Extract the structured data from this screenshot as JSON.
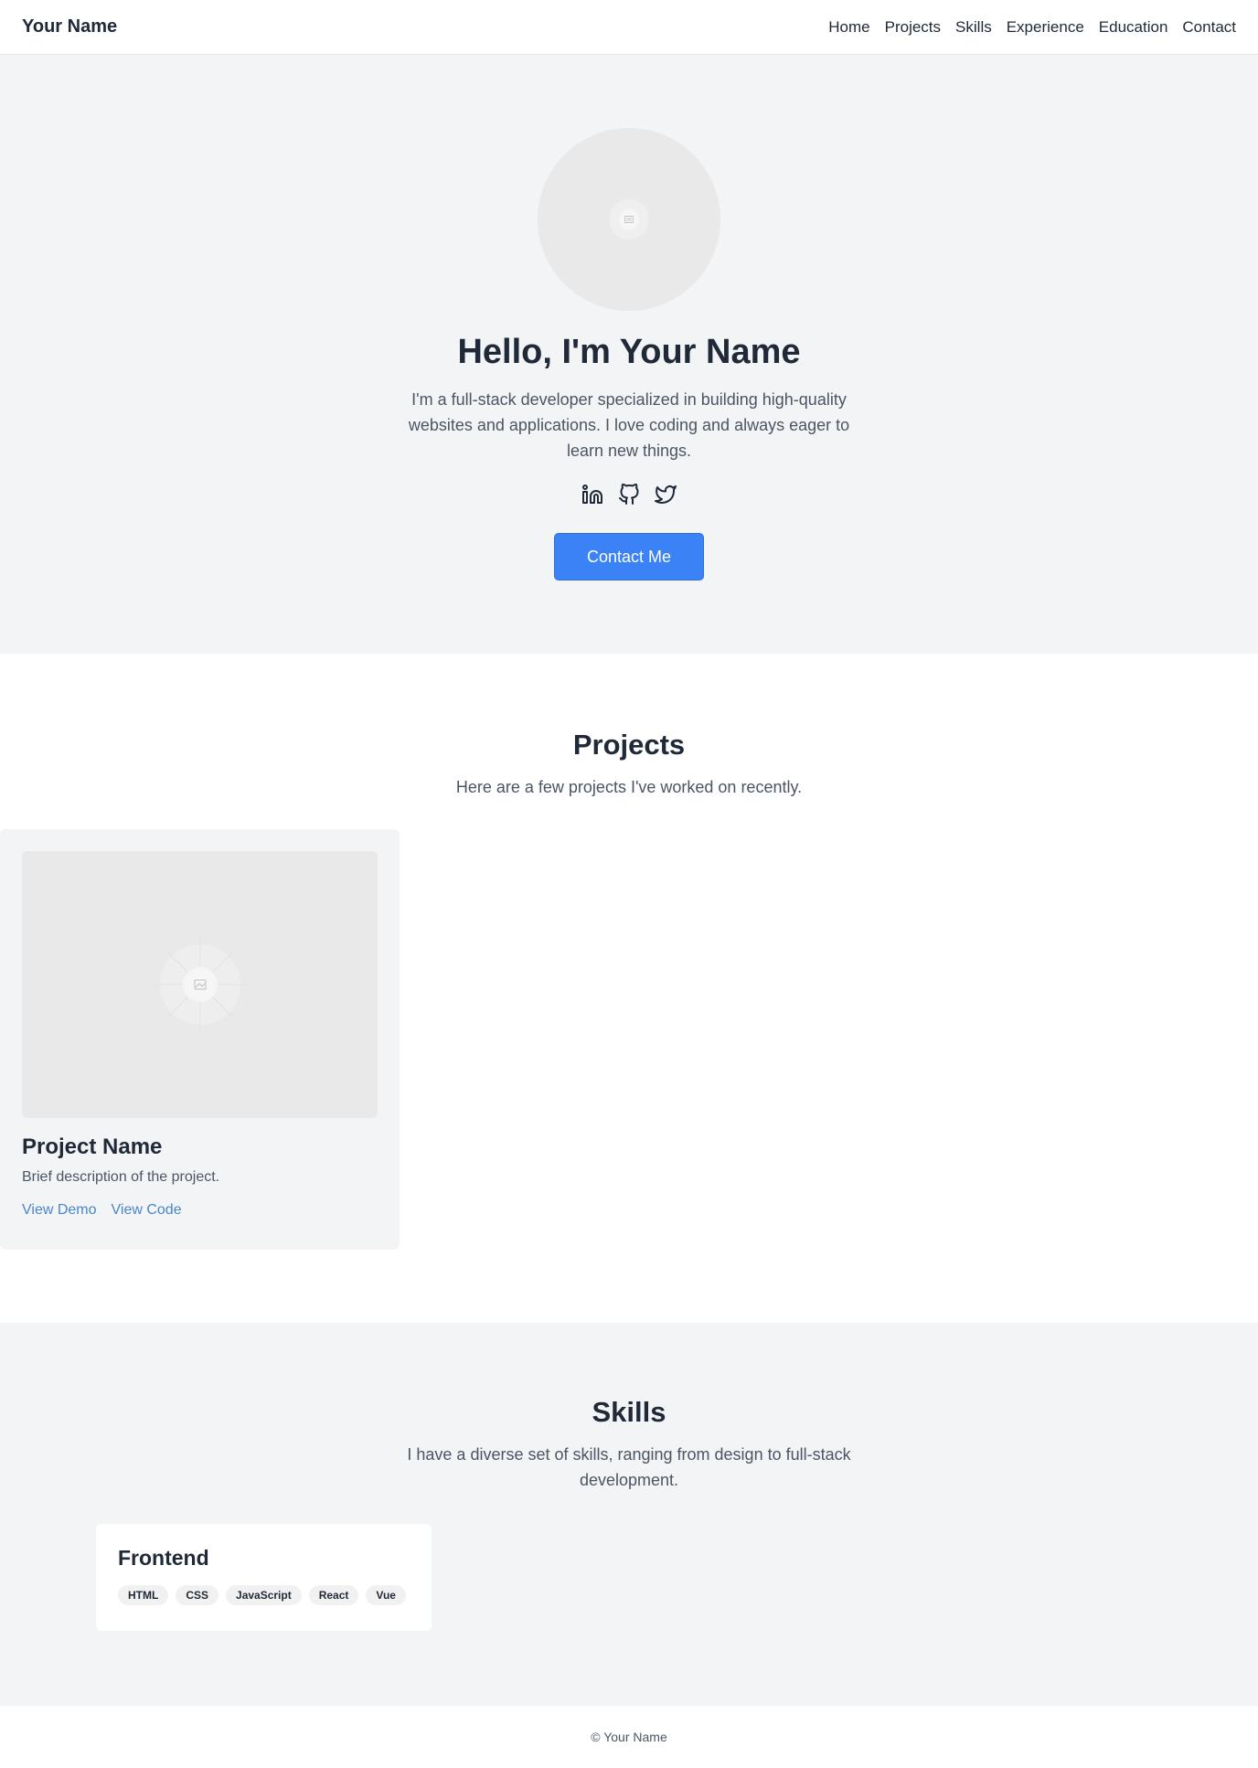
{
  "nav": {
    "brand": "Your Name",
    "links": [
      "Home",
      "Projects",
      "Skills",
      "Experience",
      "Education",
      "Contact"
    ]
  },
  "hero": {
    "title": "Hello, I'm Your Name",
    "bio": "I'm a full-stack developer specialized in building high-quality websites and applications. I love coding and always eager to learn new things.",
    "socials": [
      "linkedin-icon",
      "github-icon",
      "twitter-icon"
    ],
    "cta_label": "Contact Me",
    "cta_color": "#3b82f6"
  },
  "projects": {
    "title": "Projects",
    "subtitle": "Here are a few projects I've worked on recently.",
    "cards": [
      {
        "name": "Project Name",
        "description": "Brief description of the project.",
        "demo_label": "View Demo",
        "code_label": "View Code"
      }
    ]
  },
  "skills": {
    "title": "Skills",
    "subtitle": "I have a diverse set of skills, ranging from design to full-stack development.",
    "groups": [
      {
        "title": "Frontend",
        "tags": [
          "HTML",
          "CSS",
          "JavaScript",
          "React",
          "Vue"
        ]
      }
    ]
  },
  "footer": {
    "text": "© Your Name"
  },
  "colors": {
    "background_alt": "#f3f4f6",
    "text_primary": "#1f2937",
    "text_secondary": "#4b5563",
    "link": "#4a86c8"
  }
}
